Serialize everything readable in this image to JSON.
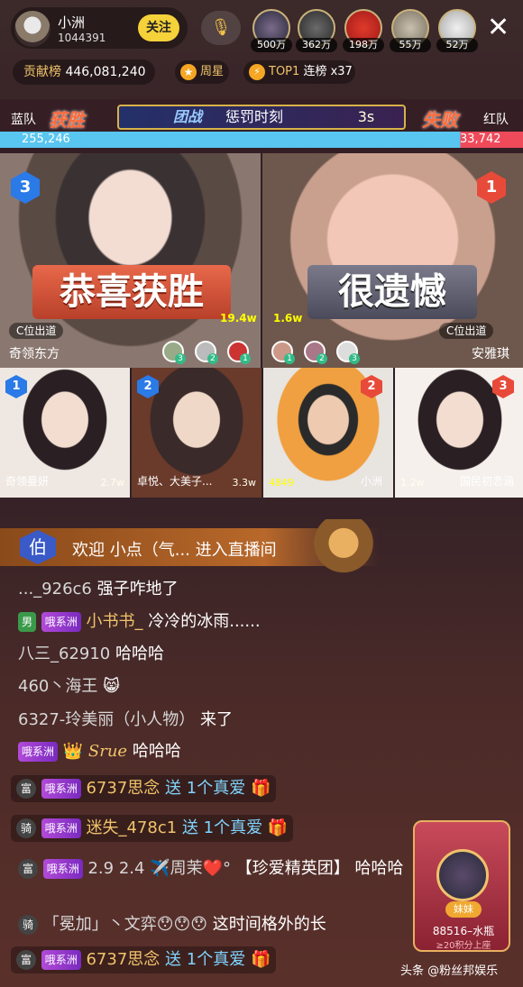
{
  "header": {
    "host_name": "小洲",
    "host_id": "1044391",
    "follow_label": "关注",
    "mic_icon": "mic-users-icon",
    "viewers": [
      "500万",
      "362万",
      "198万",
      "55万",
      "52万"
    ],
    "close_icon": "close-icon",
    "contrib_label": "贡献榜",
    "contrib_value": "446,081,240",
    "week_star": "周星",
    "top_label": "TOP1",
    "streak": "连榜 x37"
  },
  "pk": {
    "blue_label": "蓝队",
    "blue_score": "255,246",
    "win": "获胜",
    "mode": "团战",
    "phase": "惩罚时刻",
    "seconds": "3s",
    "lose": "失败",
    "red_label": "红队",
    "red_score": "33,742",
    "blue_share": 0.88
  },
  "cams": {
    "left": {
      "rank": "3",
      "big": "恭喜获胜",
      "cpos": "C位出道",
      "score": "19.4w",
      "name": "奇领东方",
      "minis": [
        "3",
        "2",
        "1"
      ]
    },
    "right": {
      "rank": "1",
      "big": "很遗憾",
      "cpos": "C位出道",
      "score": "1.6w",
      "name": "安雅琪",
      "minis": [
        "1",
        "2",
        "3"
      ]
    }
  },
  "small_cams": [
    {
      "rank": "1",
      "name": "奇领曼妍",
      "value": "2.7w"
    },
    {
      "rank": "2",
      "name": "卓悦、大美子...",
      "value": "3.3w"
    },
    {
      "rank": "2",
      "name": "小洲",
      "value": "4849"
    },
    {
      "rank": "3",
      "name": "国民初恋涵",
      "value": "1.2w"
    }
  ],
  "welcome": {
    "badge": "伯",
    "text": "欢迎  小点（气...  进入直播间"
  },
  "chat": [
    {
      "user": "..._926c6",
      "text": "强子咋地了"
    },
    {
      "badge": "男",
      "group": "哦系洲",
      "user": "小书书_",
      "text": "冷冷的冰雨......"
    },
    {
      "user": "八三_62910",
      "text": "哈哈哈"
    },
    {
      "user": "460丶海王",
      "text": "😸"
    },
    {
      "user": "6327-玲美丽（小人物）",
      "text": "来了"
    },
    {
      "group": "哦系洲",
      "user": "Srue",
      "text": "哈哈哈"
    },
    {
      "lvl": "富",
      "group": "哦系洲",
      "user": "6737思念",
      "send": "送",
      "gift": "1个真爱"
    },
    {
      "lvl": "骑",
      "group": "哦系洲",
      "user": "迷失_478c1",
      "send": "送",
      "gift": "1个真爱"
    },
    {
      "lvl": "富",
      "group": "哦系洲",
      "user": "2.9 2.4 ✈️周茉❤️°",
      "text": "【珍爱精英团】 哈哈哈"
    },
    {
      "lvl": "骑",
      "user": "「冕加」丶文弈😯😯😯",
      "text": "这时间格外的长"
    },
    {
      "lvl": "富",
      "group": "哦系洲",
      "user": "6737思念",
      "send": "送",
      "gift": "1个真爱"
    }
  ],
  "card": {
    "name": "妹妹",
    "line1": "88516–水瓶",
    "line2": "≥20积分上座"
  },
  "watermark": "头条 @粉丝邦娱乐"
}
